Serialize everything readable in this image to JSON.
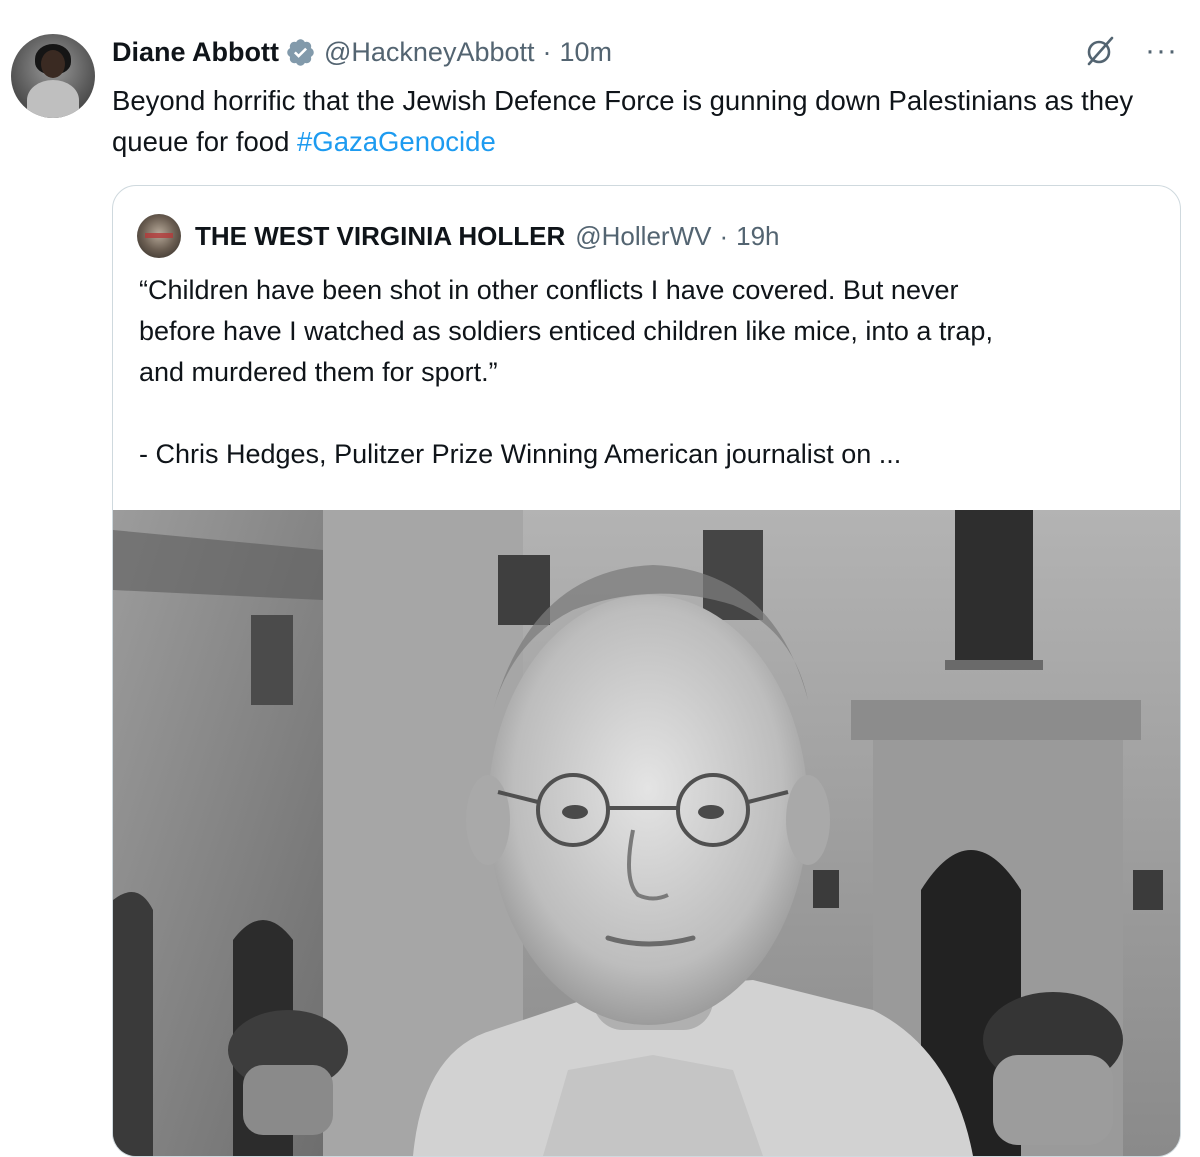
{
  "tweet": {
    "author_name": "Diane Abbott",
    "handle": "@HackneyAbbott",
    "separator": "·",
    "time": "10m",
    "text_plain": "Beyond horrific that the Jewish Defence Force is gunning down Palestinians as they queue for food ",
    "hashtag": "#GazaGenocide",
    "icons": {
      "verified": "verified-badge-icon",
      "grok": "grok-icon",
      "more": "more-options-icon"
    },
    "more_glyph": "···"
  },
  "quote": {
    "author_name": "THE WEST VIRGINIA HOLLER",
    "handle": "@HollerWV",
    "separator": "·",
    "time": "19h",
    "text_line_1": "“Children have been shot in other conflicts I have covered. But never",
    "text_line_2": "before have I watched as soldiers enticed children like mice, into a trap,",
    "text_line_3": "and murdered them for sport.”",
    "text_line_4": "- Chris Hedges, Pulitzer Prize Winning American journalist on ..."
  },
  "colors": {
    "text_primary": "#0f1419",
    "text_secondary": "#536471",
    "link": "#1d9bf0",
    "verified": "#829aab",
    "border": "#cfd9de"
  }
}
